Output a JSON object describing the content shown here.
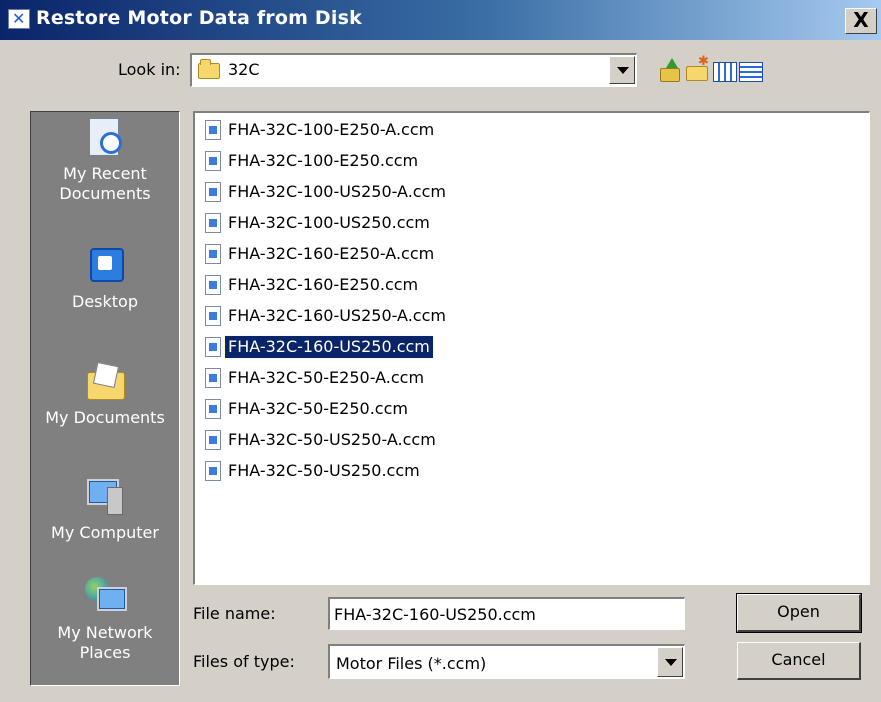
{
  "window": {
    "title": "Restore Motor Data from Disk",
    "close_label": "X"
  },
  "lookin": {
    "label": "Look in:",
    "value": "32C"
  },
  "toolbar": {
    "icons": [
      "up-one-level-icon",
      "create-new-folder-icon",
      "list-view-icon",
      "details-view-icon"
    ]
  },
  "places": [
    {
      "label": "My Recent Documents",
      "icon": "recent-documents-icon"
    },
    {
      "label": "Desktop",
      "icon": "desktop-icon"
    },
    {
      "label": "My Documents",
      "icon": "my-documents-icon"
    },
    {
      "label": "My Computer",
      "icon": "my-computer-icon"
    },
    {
      "label": "My Network Places",
      "icon": "network-places-icon"
    }
  ],
  "files": [
    "FHA-32C-100-E250-A.ccm",
    "FHA-32C-100-E250.ccm",
    "FHA-32C-100-US250-A.ccm",
    "FHA-32C-100-US250.ccm",
    "FHA-32C-160-E250-A.ccm",
    "FHA-32C-160-E250.ccm",
    "FHA-32C-160-US250-A.ccm",
    "FHA-32C-160-US250.ccm",
    "FHA-32C-50-E250-A.ccm",
    "FHA-32C-50-E250.ccm",
    "FHA-32C-50-US250-A.ccm",
    "FHA-32C-50-US250.ccm"
  ],
  "selected_file": "FHA-32C-160-US250.ccm",
  "filename": {
    "label": "File name:",
    "value": "FHA-32C-160-US250.ccm"
  },
  "filetype": {
    "label": "Files of type:",
    "value": "Motor Files (*.ccm)"
  },
  "buttons": {
    "open": "Open",
    "cancel": "Cancel"
  },
  "colors": {
    "title_bar": "#0a246a",
    "selection": "#0a246a",
    "dialog_face": "#d4d0c8",
    "places_bar": "#808080"
  }
}
